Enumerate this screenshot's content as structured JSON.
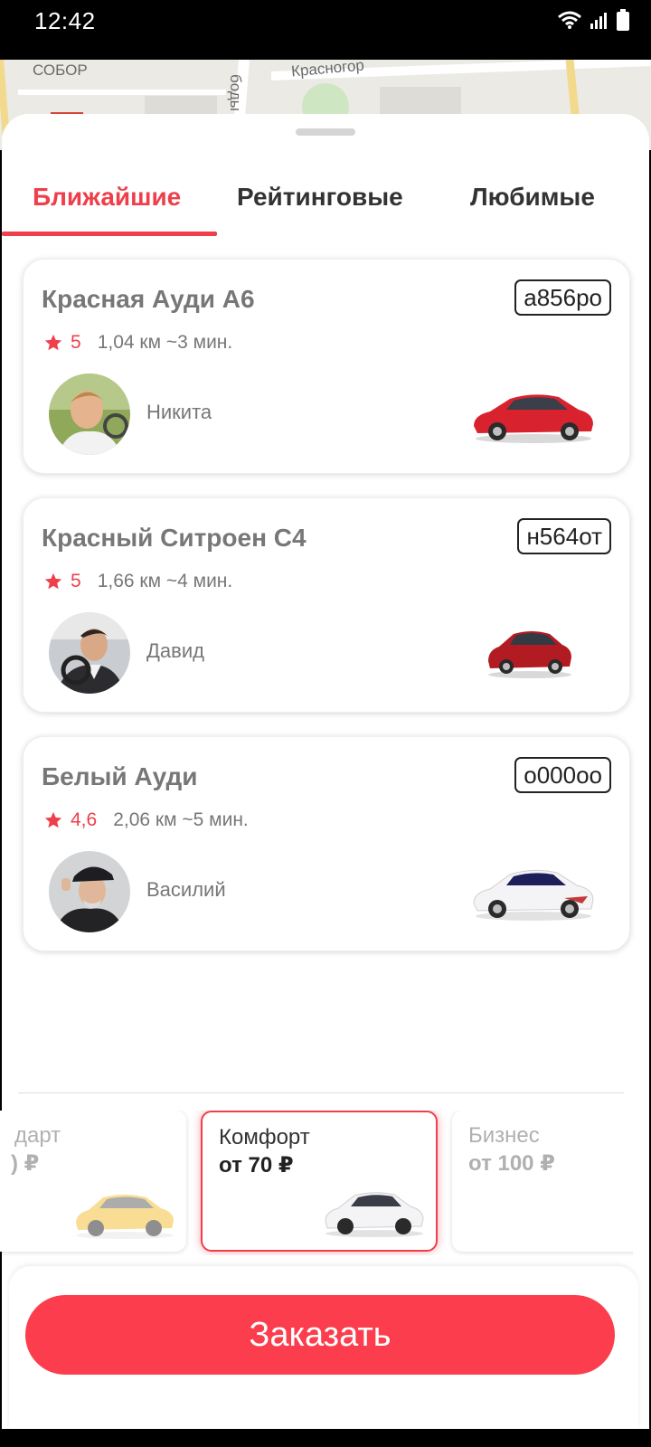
{
  "status_bar": {
    "time": "12:42",
    "icons": [
      "wifi-icon",
      "cellular-signal-icon",
      "battery-icon"
    ]
  },
  "map": {
    "labels": [
      "СОБОР",
      "боды",
      "Красногор"
    ]
  },
  "tabs": [
    {
      "label": "Ближайшие",
      "active": true
    },
    {
      "label": "Рейтинговые",
      "active": false
    },
    {
      "label": "Любимые",
      "active": false
    }
  ],
  "drivers": [
    {
      "car": "Красная Ауди А6",
      "plate": "а856ро",
      "rating": "5",
      "distance": "1,04 км ~3 мин.",
      "driver": "Никита",
      "car_color": "#d8232f"
    },
    {
      "car": "Красный Ситроен С4",
      "plate": "н564от",
      "rating": "5",
      "distance": "1,66 км ~4 мин.",
      "driver": "Давид",
      "car_color": "#b31b22"
    },
    {
      "car": "Белый Ауди",
      "plate": "о000оо",
      "rating": "4,6",
      "distance": "2,06 км ~5 мин.",
      "driver": "Василий",
      "car_color": "#f4f4f6"
    }
  ],
  "tariffs": [
    {
      "name": "дарт",
      "price": ") ₽",
      "selected": false,
      "car_color": "#f6c23e"
    },
    {
      "name": "Комфорт",
      "price": "от 70 ₽",
      "selected": true,
      "car_color": "#f4f4f6"
    },
    {
      "name": "Бизнес",
      "price": "от 100 ₽",
      "selected": false,
      "car_color": "#7b7d85"
    }
  ],
  "order_button": "Заказать",
  "colors": {
    "accent": "#ee3f4b",
    "button": "#fb3d4d"
  }
}
